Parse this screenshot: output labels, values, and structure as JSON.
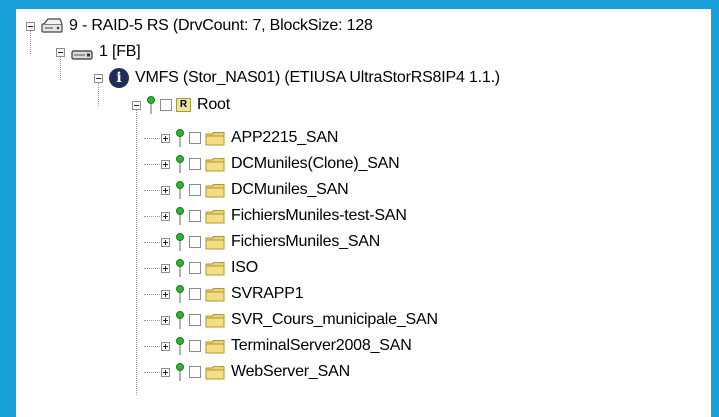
{
  "tree": {
    "raid": {
      "label": "9 - RAID-5 RS (DrvCount: 7, BlockSize: 128",
      "icon": "raid-icon"
    },
    "disk": {
      "label": "1 [FB]",
      "icon": "disk-icon"
    },
    "vmfs": {
      "label": "VMFS (Stor_NAS01) (ETIUSA  UltraStorRS8IP4 1.1.)",
      "icon": "info-icon",
      "icon_glyph": "i"
    },
    "root": {
      "label": "Root",
      "badge": "R"
    },
    "folders": [
      {
        "label": "APP2215_SAN"
      },
      {
        "label": "DCMuniles(Clone)_SAN"
      },
      {
        "label": "DCMuniles_SAN"
      },
      {
        "label": "FichiersMuniles-test-SAN"
      },
      {
        "label": "FichiersMuniles_SAN"
      },
      {
        "label": "ISO"
      },
      {
        "label": "SVRAPP1"
      },
      {
        "label": "SVR_Cours_municipale_SAN"
      },
      {
        "label": "TerminalServer2008_SAN"
      },
      {
        "label": "WebServer_SAN"
      }
    ]
  },
  "colors": {
    "accent": "#1aa0d8",
    "folder": "#e8d27a",
    "pin": "#2fb52f",
    "info": "#1f2c5c"
  }
}
